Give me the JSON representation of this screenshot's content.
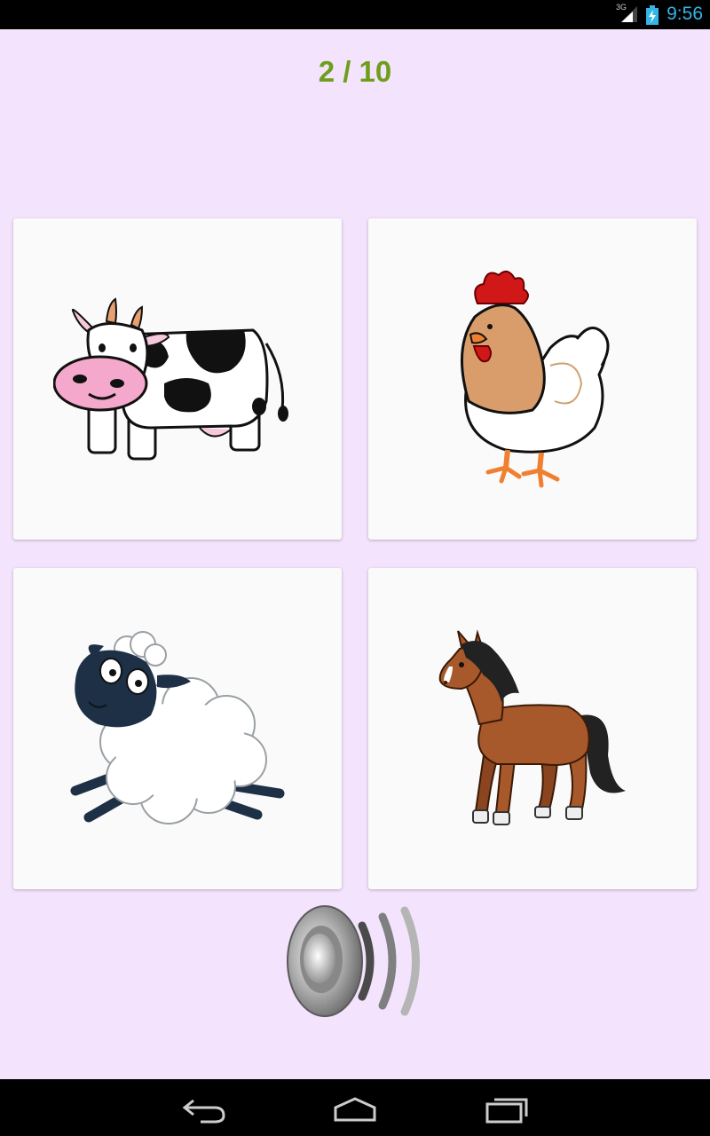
{
  "status_bar": {
    "network": "3G",
    "time": "9:56",
    "icons": [
      "signal-icon",
      "battery-icon"
    ]
  },
  "quiz": {
    "progress": "2 / 10",
    "current": 2,
    "total": 10
  },
  "cards": [
    {
      "animal": "cow",
      "icon": "cow-icon"
    },
    {
      "animal": "hen",
      "icon": "hen-icon"
    },
    {
      "animal": "sheep",
      "icon": "sheep-icon"
    },
    {
      "animal": "horse",
      "icon": "horse-icon"
    }
  ],
  "sound_button": {
    "icon": "speaker-icon"
  },
  "nav_bar": {
    "buttons": [
      "back-icon",
      "home-icon",
      "recent-apps-icon"
    ]
  },
  "colors": {
    "background": "#f3e3fc",
    "progress_text": "#6f9e1a",
    "card": "#fafafa",
    "status_accent": "#33b5e5"
  }
}
